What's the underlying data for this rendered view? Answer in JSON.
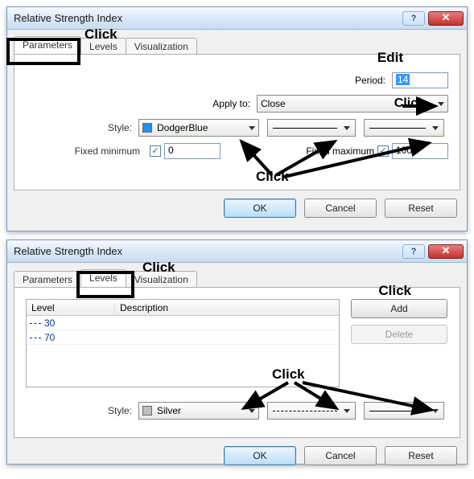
{
  "dialog1": {
    "title": "Relative Strength Index",
    "help": "?",
    "close": "✕",
    "tabs": {
      "parameters": "Parameters",
      "levels": "Levels",
      "visualization": "Visualization"
    },
    "period_label": "Period:",
    "period_value": "14",
    "applyto_label": "Apply to:",
    "applyto_value": "Close",
    "style_label": "Style:",
    "style_color_name": "DodgerBlue",
    "style_color_hex": "#1e90ff",
    "fixed_min_label": "Fixed minimum",
    "fixed_min_value": "0",
    "fixed_max_label": "Fixed maximum",
    "fixed_max_value": "100",
    "ok": "OK",
    "cancel": "Cancel",
    "reset": "Reset",
    "anno_click_tab": "Click",
    "anno_edit": "Edit",
    "anno_click_apply": "Click",
    "anno_click_style": "Click"
  },
  "dialog2": {
    "title": "Relative Strength Index",
    "help": "?",
    "close": "✕",
    "tabs": {
      "parameters": "Parameters",
      "levels": "Levels",
      "visualization": "Visualization"
    },
    "col_level": "Level",
    "col_desc": "Description",
    "levels": [
      {
        "value": "30"
      },
      {
        "value": "70"
      }
    ],
    "add": "Add",
    "delete": "Delete",
    "style_label": "Style:",
    "style_color_name": "Silver",
    "style_color_hex": "#c0c0c0",
    "ok": "OK",
    "cancel": "Cancel",
    "reset": "Reset",
    "anno_click_tab": "Click",
    "anno_click_add": "Click",
    "anno_click_style": "Click"
  }
}
